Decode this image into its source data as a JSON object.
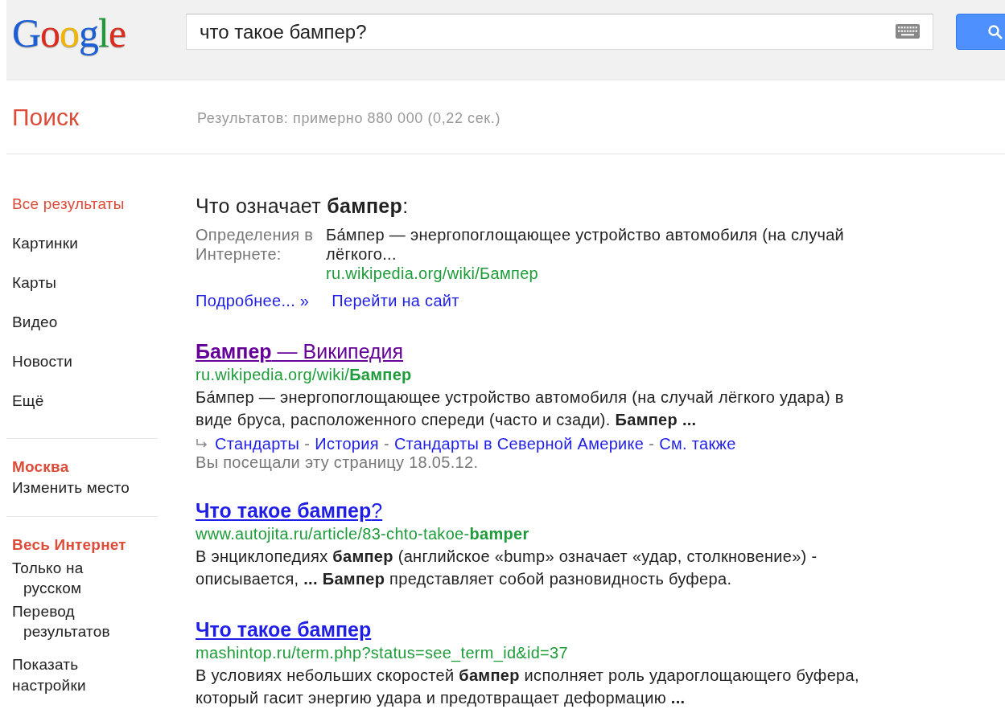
{
  "logo": "Google",
  "search": {
    "value": "что такое бампер?"
  },
  "section_title": "Поиск",
  "results_count": "Результатов: примерно 880 000 (0,22 сек.)",
  "sidebar": {
    "items": [
      {
        "label": "Все результаты",
        "selected": true
      },
      {
        "label": "Картинки",
        "selected": false
      },
      {
        "label": "Карты",
        "selected": false
      },
      {
        "label": "Видео",
        "selected": false
      },
      {
        "label": "Новости",
        "selected": false
      },
      {
        "label": "Ещё",
        "selected": false
      }
    ],
    "location": {
      "title": "Москва",
      "link": "Изменить место"
    },
    "filters": [
      {
        "label": "Весь Интернет",
        "selected": true
      },
      {
        "label": "Только на русском",
        "selected": false
      },
      {
        "label": "Перевод результатов",
        "selected": false
      }
    ],
    "settings": "Показать настройки"
  },
  "definition": {
    "heading": "Что означает **бампер**:",
    "label": "Определения в Интернете:",
    "text": "Ба́мпер — энергопоглощающее устройство автомобиля (на случай лёгкого...",
    "url": "ru.wikipedia.org/wiki/Бампер",
    "links": [
      "Подробнее... »",
      "Перейти на сайт"
    ]
  },
  "results": [
    {
      "title": "**Бампер** — Википедия",
      "visited": true,
      "url": "ru.wikipedia.org/wiki/**Бампер**",
      "snippet": "Ба́мпер — энергопоглощающее устройство автомобиля (на случай лёгкого удара) в виде бруса, расположенного спереди (часто и сзади). **Бампер ...**",
      "sitelinks": [
        "Стандарты",
        "История",
        "Стандарты в Северной Америке",
        "См. также"
      ],
      "sitelink_separator": "-",
      "visited_note": "Вы посещали эту страницу 18.05.12."
    },
    {
      "title": "**Что такое бампер**?",
      "visited": false,
      "url": "www.autojita.ru/article/83-chto-takoe-**bamper**",
      "snippet": "В энциклопедиях **бампер** (английское «bump» означает «удар, столкновение») - описывается, **...** **Бампер** представляет собой разновидность буфера."
    },
    {
      "title": "**Что такое бампер**",
      "visited": false,
      "url": "mashintop.ru/term.php?status=see_term_id&id=37",
      "snippet": "В условиях небольших скоростей **бампер** исполняет роль удароглощающего буфера, который гасит энергию удара и предотвращает деформацию **...**"
    }
  ]
}
